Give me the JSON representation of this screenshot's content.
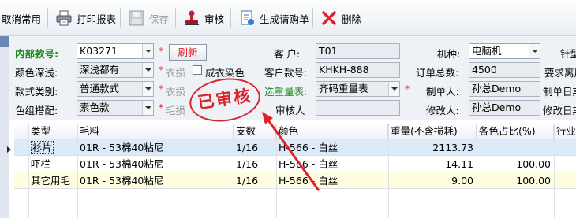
{
  "toolbar": {
    "cancel_label": "取消常用",
    "print_label": "打印报表",
    "save_label": "保存",
    "audit_label": "审核",
    "generate_label": "生成请购单",
    "delete_label": "删除"
  },
  "form": {
    "internal_no_label": "内部款号:",
    "internal_no_value": "K03271",
    "refresh_label": "刷新",
    "customer_label": "客  户:",
    "customer_value": "T01",
    "machine_label": "机种:",
    "machine_value": "电脑机",
    "needle_label": "针型",
    "color_depth_label": "颜色深浅:",
    "color_depth_value": "深浅都有",
    "garment_label": "衣损",
    "dyed_label": "成衣染色",
    "customer_style_label": "客户款号:",
    "customer_style_value": "KHKH-888",
    "order_total_label": "订单总数:",
    "order_total_value": "4500",
    "requirement_label": "要求离厂",
    "style_type_label": "款式类别:",
    "style_type_value": "普通款式",
    "loss_label": "衣损",
    "weight_table_label": "选重量表:",
    "weight_table_value": "齐码重量表",
    "creator_label": "制单人:",
    "creator_value": "孙总Demo",
    "create_date_label": "制单日期",
    "color_group_label": "色组搭配:",
    "color_group_value": "素色款",
    "wool_loss_label": "毛损",
    "reviewer_label": "审核人",
    "reviewer_value": "",
    "modifier_label": "修改人:",
    "modifier_value": "孙总Demo",
    "modify_date_label": "修改日期"
  },
  "stamp": {
    "text": "已审核"
  },
  "grid": {
    "headers": [
      "类型",
      "毛料",
      "支数",
      "颜色",
      "重量(不含损耗)",
      "各色占比(%)",
      "行业"
    ],
    "rows": [
      {
        "type": "衫片",
        "material": "01R - 53棉40粘尼",
        "count": "1/16",
        "color": "H-566 - 白丝",
        "weight": "2113.73",
        "ratio": ""
      },
      {
        "type": "吓栏",
        "material": "01R - 53棉40粘尼",
        "count": "1/16",
        "color": "H-566 - 白丝",
        "weight": "14.11",
        "ratio": "100.00"
      },
      {
        "type": "其它用毛",
        "material": "01R - 53棉40粘尼",
        "count": "1/16",
        "color": "H-566 - 白丝",
        "weight": "9.00",
        "ratio": "100.00"
      }
    ]
  },
  "colors": {
    "green_label": "#1a8a1a",
    "required_star": "#e0202a",
    "stamp_red": "#d9262d",
    "row_selected": "#dbeaf8",
    "row_plain": "#ffffff",
    "row_yellow": "#fffde0"
  }
}
